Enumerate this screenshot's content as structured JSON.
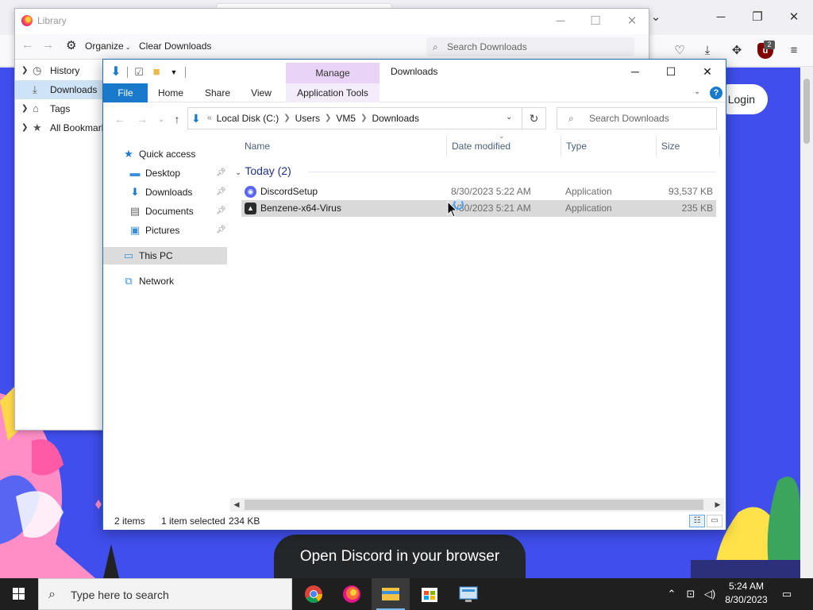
{
  "library": {
    "title": "Library",
    "toolbar": {
      "organize": "Organize",
      "clear_downloads": "Clear Downloads"
    },
    "search_placeholder": "Search Downloads",
    "tree": [
      {
        "label": "History",
        "icon": "clock-icon"
      },
      {
        "label": "Downloads",
        "icon": "download-icon",
        "selected": true
      },
      {
        "label": "Tags",
        "icon": "tag-icon"
      },
      {
        "label": "All Bookmarks",
        "icon": "star-icon"
      }
    ]
  },
  "firefox": {
    "login_label": "Login",
    "banner_text": "Open Discord in your browser",
    "ublock_badge": "2",
    "ublock_letter": "u"
  },
  "explorer": {
    "manage_tab": "Manage",
    "title": "Downloads",
    "ribbon_tabs": [
      "File",
      "Home",
      "Share",
      "View",
      "Application Tools"
    ],
    "address": {
      "prefix": "«",
      "crumbs": [
        "Local Disk (C:)",
        "Users",
        "VM5",
        "Downloads"
      ]
    },
    "search_placeholder": "Search Downloads",
    "nav_pane": {
      "quick_access": "Quick access",
      "pinned": [
        {
          "label": "Desktop",
          "icon": "desktop-icon"
        },
        {
          "label": "Downloads",
          "icon": "downloads-folder-icon"
        },
        {
          "label": "Documents",
          "icon": "documents-icon"
        },
        {
          "label": "Pictures",
          "icon": "pictures-icon"
        }
      ],
      "this_pc": "This PC",
      "network": "Network"
    },
    "columns": {
      "name": "Name",
      "date": "Date modified",
      "type": "Type",
      "size": "Size"
    },
    "group": {
      "label": "Today (2)"
    },
    "files": [
      {
        "name": "DiscordSetup",
        "date": "8/30/2023 5:22 AM",
        "type": "Application",
        "size": "93,537 KB",
        "selected": false
      },
      {
        "name": "Benzene-x64-Virus",
        "date": "8/30/2023 5:21 AM",
        "type": "Application",
        "size": "235 KB",
        "selected": true
      }
    ],
    "status": {
      "items": "2 items",
      "selected": "1 item selected",
      "size": "234 KB"
    }
  },
  "taskbar": {
    "search_placeholder": "Type here to search",
    "time": "5:24 AM",
    "date": "8/30/2023"
  },
  "colors": {
    "discord_blurple": "#404eed",
    "file_tab_blue": "#1979ca",
    "manage_purple": "#e9d4f7"
  }
}
